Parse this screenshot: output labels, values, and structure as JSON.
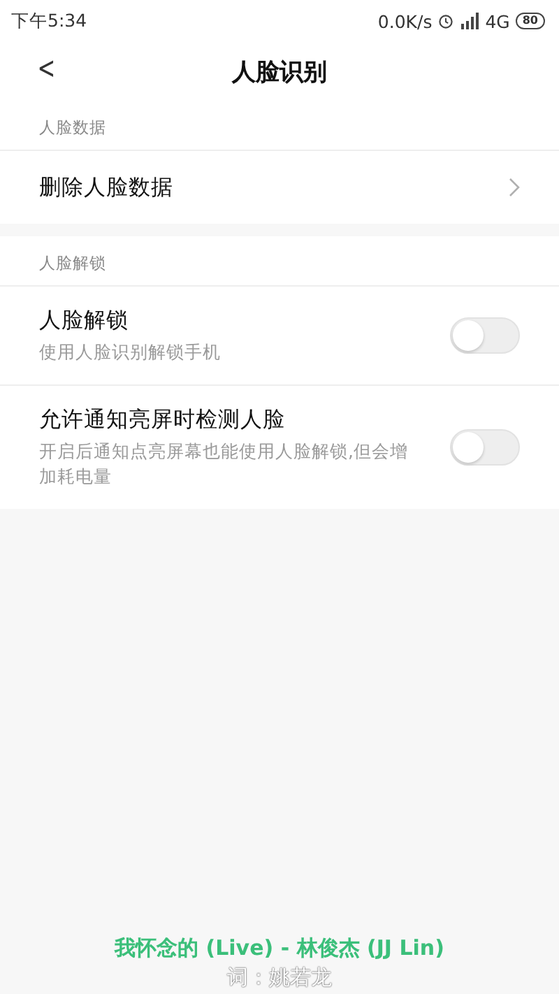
{
  "status_bar": {
    "time": "下午5:34",
    "speed": "0.0K/s",
    "network": "4G",
    "battery": "80"
  },
  "header": {
    "back": "<",
    "title": "人脸识别"
  },
  "sections": [
    {
      "label": "人脸数据",
      "rows": [
        {
          "kind": "link",
          "title": "删除人脸数据"
        }
      ]
    },
    {
      "label": "人脸解锁",
      "rows": [
        {
          "kind": "toggle",
          "title": "人脸解锁",
          "subtitle": "使用人脸识别解锁手机",
          "on": false
        },
        {
          "kind": "toggle",
          "title": "允许通知亮屏时检测人脸",
          "subtitle": "开启后通知点亮屏幕也能使用人脸解锁,但会增加耗电量",
          "on": false
        }
      ]
    }
  ],
  "lyrics": {
    "line": "我怀念的 (Live) - 林俊杰 (JJ Lin)",
    "credit": "词：姚若龙"
  }
}
